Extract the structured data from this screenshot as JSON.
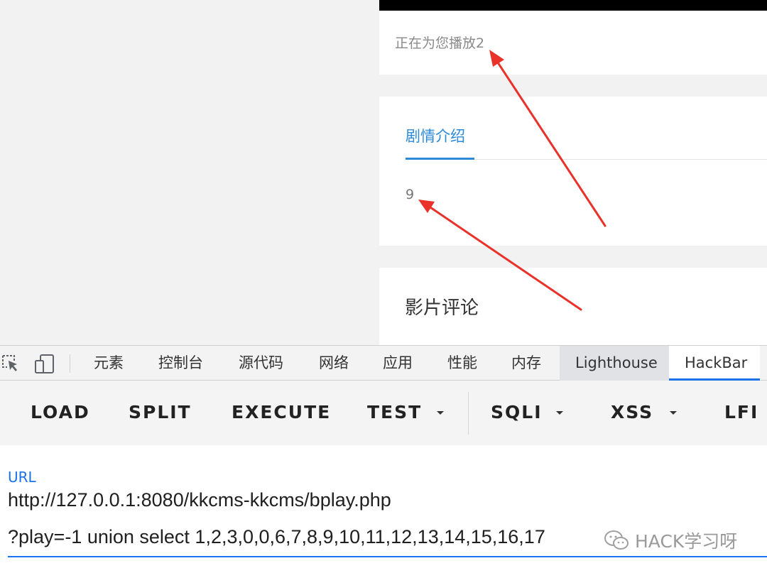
{
  "page": {
    "now_playing": "正在为您播放2",
    "plot_tab": "剧情介绍",
    "plot_value": "9",
    "comments_title": "影片评论"
  },
  "devtools": {
    "tabs": [
      "元素",
      "控制台",
      "源代码",
      "网络",
      "应用",
      "性能",
      "内存",
      "Lighthouse",
      "HackBar"
    ],
    "active_tab": "HackBar",
    "icons": [
      "inspect-element-icon",
      "device-toolbar-icon"
    ]
  },
  "hackbar": {
    "buttons": [
      {
        "label": "LOAD",
        "has_dropdown": false
      },
      {
        "label": "SPLIT",
        "has_dropdown": false
      },
      {
        "label": "EXECUTE",
        "has_dropdown": false
      },
      {
        "label": "TEST",
        "has_dropdown": true
      },
      {
        "label": "SQLI",
        "has_dropdown": true
      },
      {
        "label": "XSS",
        "has_dropdown": true
      },
      {
        "label": "LFI",
        "has_dropdown": false
      }
    ],
    "url_label": "URL",
    "url_line1": "http://127.0.0.1:8080/kkcms-kkcms/bplay.php",
    "url_line2": "?play=-1 union select 1,2,3,0,0,6,7,8,9,10,11,12,13,14,15,16,17"
  },
  "watermark": {
    "text": "HACK学习呀",
    "icon": "wechat-icon"
  },
  "colors": {
    "accent_blue": "#1a73e8",
    "tab_blue": "#2d8ad8",
    "arrow_red": "#e8322a"
  }
}
